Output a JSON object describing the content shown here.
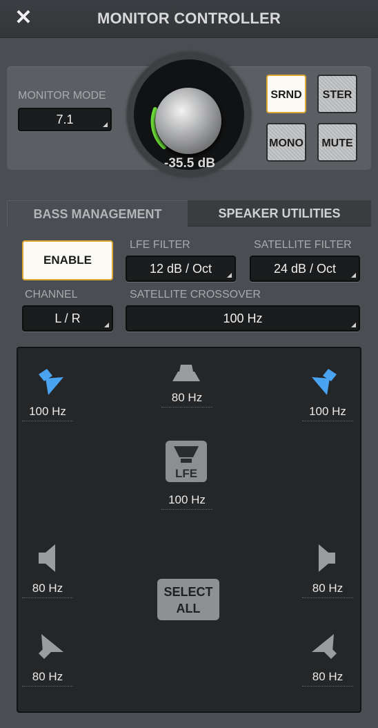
{
  "window": {
    "title": "MONITOR CONTROLLER"
  },
  "monitor": {
    "mode_label": "MONITOR MODE",
    "mode_value": "7.1",
    "knob_value": "-35.5 dB",
    "buttons": {
      "srnd": "SRND",
      "ster": "STER",
      "mono": "MONO",
      "mute": "MUTE"
    }
  },
  "tabs": {
    "bass": "BASS MANAGEMENT",
    "speaker": "SPEAKER UTILITIES"
  },
  "bass": {
    "enable_label": "ENABLE",
    "lfe_filter_label": "LFE FILTER",
    "lfe_filter_value": "12 dB / Oct",
    "sat_filter_label": "SATELLITE FILTER",
    "sat_filter_value": "24 dB / Oct",
    "channel_label": "CHANNEL",
    "channel_value": "L / R",
    "crossover_label": "SATELLITE CROSSOVER",
    "crossover_value": "100 Hz"
  },
  "speakers": {
    "front_left": "100 Hz",
    "center": "80 Hz",
    "front_right": "100 Hz",
    "lfe_label": "LFE",
    "lfe": "100 Hz",
    "side_left": "80 Hz",
    "side_right": "80 Hz",
    "rear_left": "80 Hz",
    "rear_right": "80 Hz",
    "select_all": "SELECT ALL"
  },
  "colors": {
    "accent": "#e0a733",
    "selected_speaker": "#4aa3f0",
    "meter": "#6fe03a"
  }
}
